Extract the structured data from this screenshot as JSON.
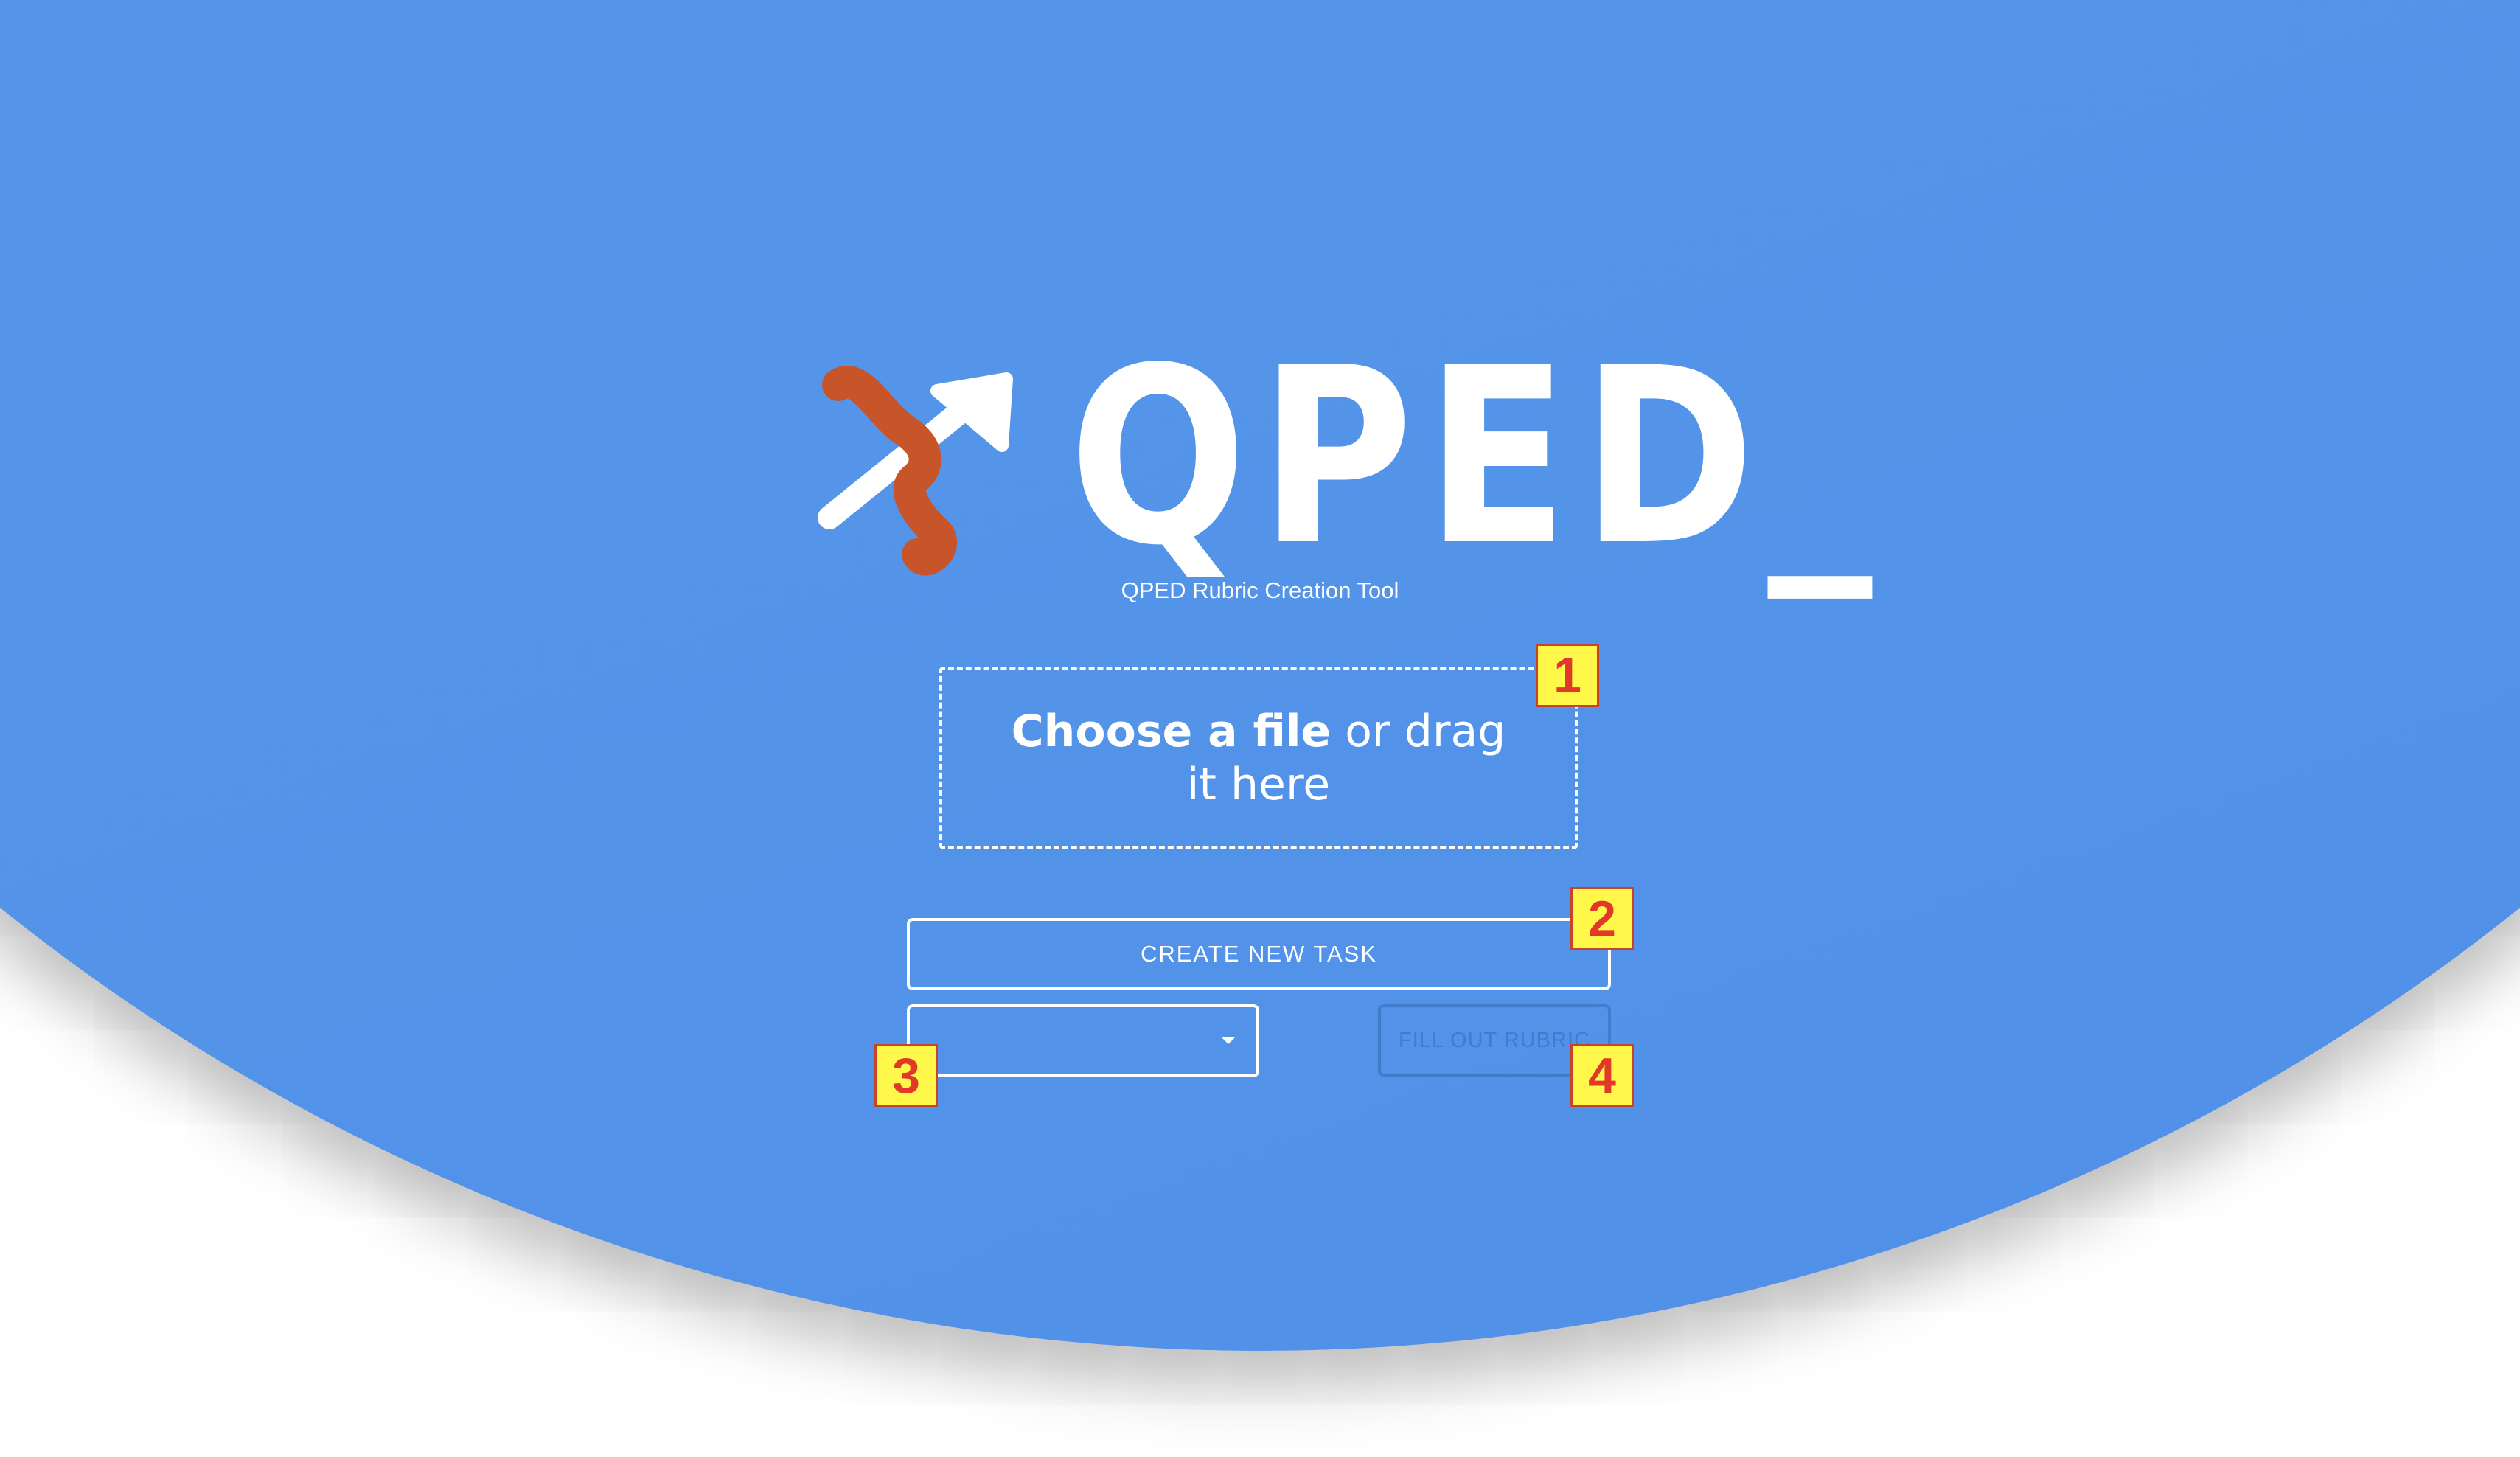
{
  "brand": {
    "wordmark": "QPED_",
    "subtitle": "QPED Rubric Creation Tool",
    "colors": {
      "background_blue": "#5797ea",
      "logo_orange": "#c8542a",
      "white": "#ffffff"
    }
  },
  "upload": {
    "choose_label": "Choose a file",
    "drag_label": " or drag it here"
  },
  "actions": {
    "create_label": "CREATE NEW TASK",
    "fill_label": "FILL OUT RUBRIC",
    "select_value": ""
  },
  "markers": {
    "m1": "1",
    "m2": "2",
    "m3": "3",
    "m4": "4"
  },
  "icons": {
    "logo": "qped-logo-icon",
    "dropdown": "chevron-down-icon"
  }
}
